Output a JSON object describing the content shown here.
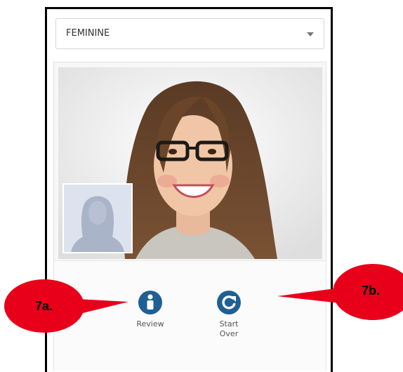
{
  "dropdown": {
    "selected": "FEMININE"
  },
  "actions": {
    "review_label": "Review",
    "start_over_label": "Start\nOver"
  },
  "callouts": {
    "a_label": "7a.",
    "b_label": "7b."
  },
  "colors": {
    "icon_blue": "#1f5f94",
    "callout_red": "#e8001a"
  },
  "icons": {
    "review": "info-person-icon",
    "start_over": "refresh-icon"
  }
}
